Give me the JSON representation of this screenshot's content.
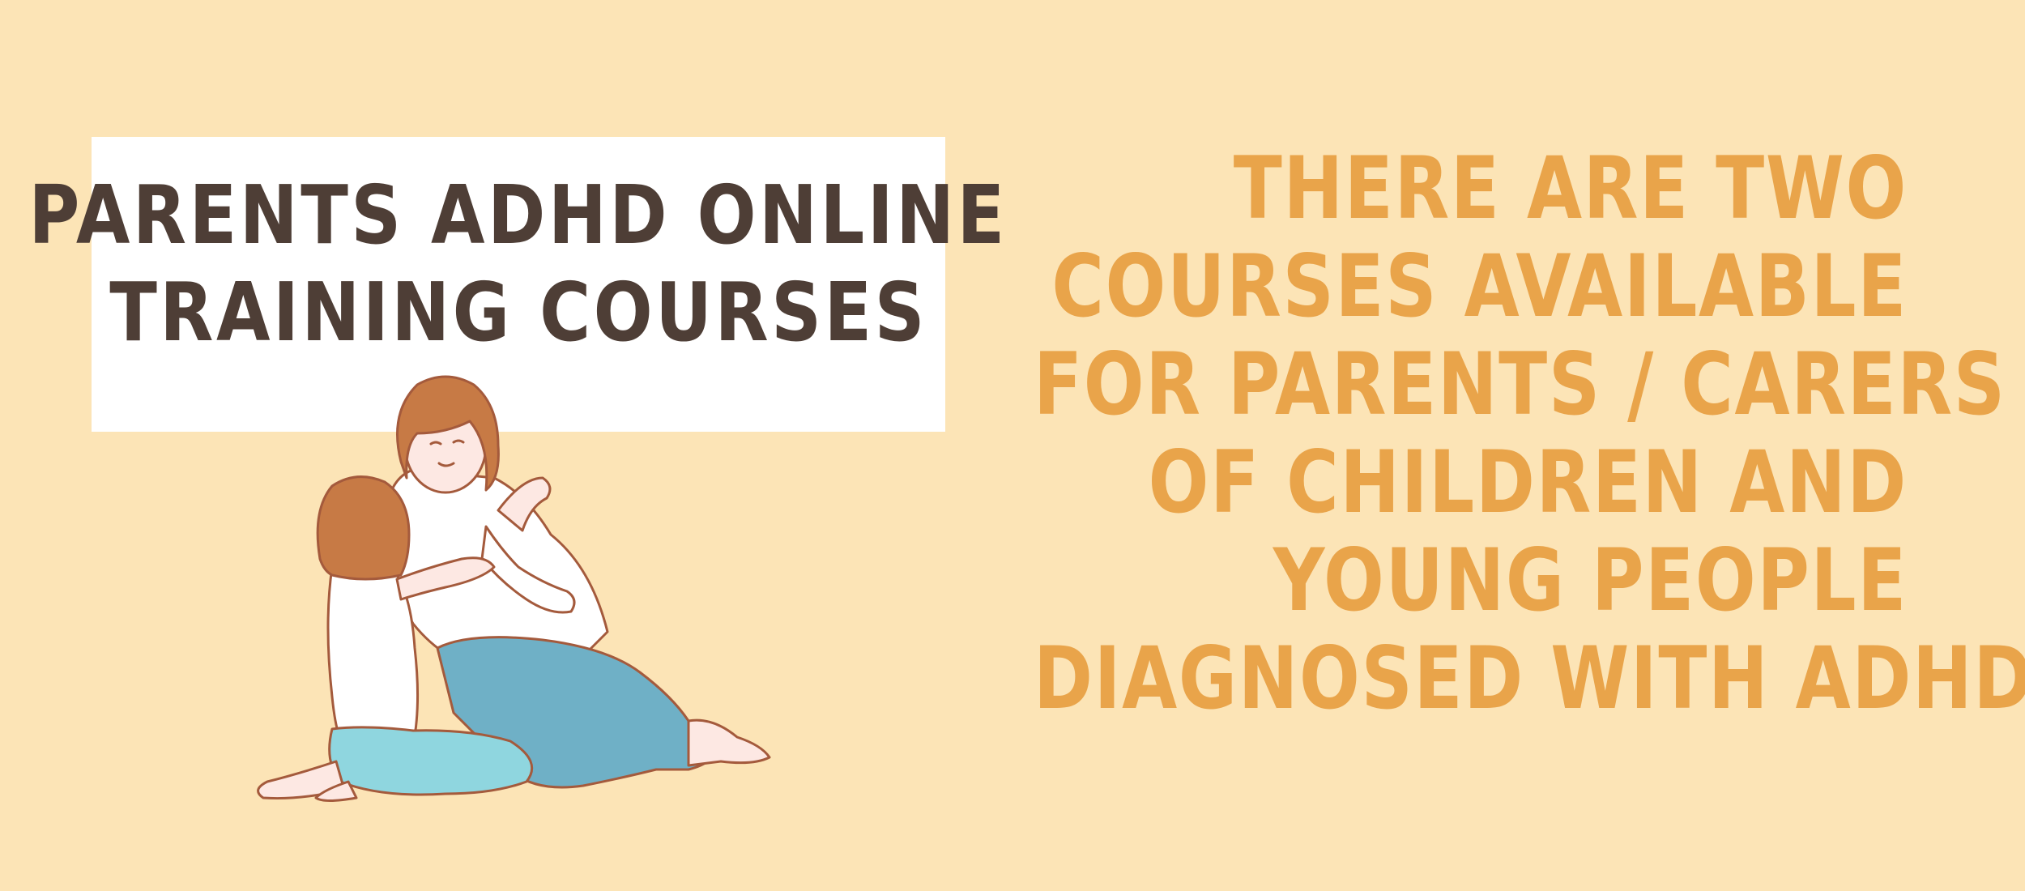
{
  "title": {
    "line1": "PARENTS ADHD ONLINE",
    "line2": "TRAINING COURSES"
  },
  "message": {
    "lines": [
      "THERE ARE TWO",
      "COURSES AVAILABLE",
      "FOR PARENTS / CARERS",
      "OF CHILDREN AND",
      "YOUNG PEOPLE",
      "DIAGNOSED WITH ADHD."
    ]
  },
  "illustration": {
    "icon": "parent-and-child-illustration"
  },
  "colors": {
    "background": "#fce4b6",
    "title_box": "#ffffff",
    "title_text": "#4e3e36",
    "message_text": "#e9a44a",
    "hair": "#c77a45",
    "child_pants": "#8fd6df",
    "adult_pants": "#6fb0c6",
    "outline": "#a45a3c"
  }
}
